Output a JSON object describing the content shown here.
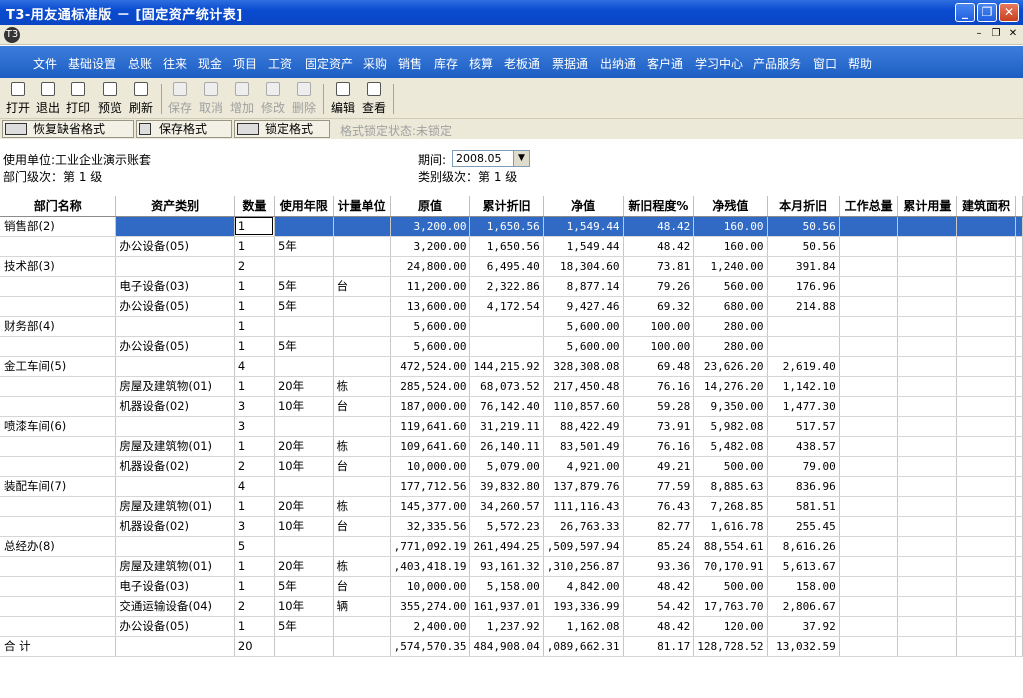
{
  "window": {
    "title": "T3-用友通标准版 － [固定资产统计表]",
    "minimize": "_",
    "restore": "❐",
    "close": "✕"
  },
  "mdi": {
    "app_icon": "T3",
    "minimize": "–",
    "restore": "❐",
    "close": "✕"
  },
  "menu": [
    "文件",
    "基础设置",
    "总账",
    "往来",
    "现金",
    "项目",
    "工资",
    "固定资产",
    "采购",
    "销售",
    "库存",
    "核算",
    "老板通",
    "票据通",
    "出纳通",
    "客户通",
    "学习中心",
    "产品服务",
    "窗口",
    "帮助"
  ],
  "toolbar": {
    "open": "打开",
    "exit": "退出",
    "print": "打印",
    "preview": "预览",
    "refresh": "刷新",
    "save": "保存",
    "cancel": "取消",
    "add": "增加",
    "modify": "修改",
    "delete": "删除",
    "edit": "编辑",
    "view": "查看"
  },
  "format": {
    "restore_default": "恢复缺省格式",
    "save_format": "保存格式",
    "lock_format": "锁定格式",
    "lock_state": "格式锁定状态:未锁定"
  },
  "info": {
    "unit_label": "使用单位:工业企业演示账套",
    "dept_level": "部门级次：第 1 级",
    "period_label": "期间:",
    "period_value": "2008.05",
    "category_level": "类别级次：第 1 级"
  },
  "table": {
    "headers": [
      "部门名称",
      "资产类别",
      "数量",
      "使用年限",
      "计量单位",
      "原值",
      "累计折旧",
      "净值",
      "新旧程度%",
      "净残值",
      "本月折旧",
      "工作总量",
      "累计用量",
      "建筑面积"
    ],
    "rows": [
      [
        "销售部(2)",
        "",
        "1",
        "",
        "",
        "3,200.00",
        "1,650.56",
        "1,549.44",
        "48.42",
        "160.00",
        "50.56"
      ],
      [
        "",
        "办公设备(05)",
        "1",
        "5年",
        "",
        "3,200.00",
        "1,650.56",
        "1,549.44",
        "48.42",
        "160.00",
        "50.56"
      ],
      [
        "技术部(3)",
        "",
        "2",
        "",
        "",
        "24,800.00",
        "6,495.40",
        "18,304.60",
        "73.81",
        "1,240.00",
        "391.84"
      ],
      [
        "",
        "电子设备(03)",
        "1",
        "5年",
        "台",
        "11,200.00",
        "2,322.86",
        "8,877.14",
        "79.26",
        "560.00",
        "176.96"
      ],
      [
        "",
        "办公设备(05)",
        "1",
        "5年",
        "",
        "13,600.00",
        "4,172.54",
        "9,427.46",
        "69.32",
        "680.00",
        "214.88"
      ],
      [
        "财务部(4)",
        "",
        "1",
        "",
        "",
        "5,600.00",
        "",
        "5,600.00",
        "100.00",
        "280.00",
        ""
      ],
      [
        "",
        "办公设备(05)",
        "1",
        "5年",
        "",
        "5,600.00",
        "",
        "5,600.00",
        "100.00",
        "280.00",
        ""
      ],
      [
        "金工车间(5)",
        "",
        "4",
        "",
        "",
        "472,524.00",
        "144,215.92",
        "328,308.08",
        "69.48",
        "23,626.20",
        "2,619.40"
      ],
      [
        "",
        "房屋及建筑物(01)",
        "1",
        "20年",
        "栋",
        "285,524.00",
        "68,073.52",
        "217,450.48",
        "76.16",
        "14,276.20",
        "1,142.10"
      ],
      [
        "",
        "机器设备(02)",
        "3",
        "10年",
        "台",
        "187,000.00",
        "76,142.40",
        "110,857.60",
        "59.28",
        "9,350.00",
        "1,477.30"
      ],
      [
        "喷漆车间(6)",
        "",
        "3",
        "",
        "",
        "119,641.60",
        "31,219.11",
        "88,422.49",
        "73.91",
        "5,982.08",
        "517.57"
      ],
      [
        "",
        "房屋及建筑物(01)",
        "1",
        "20年",
        "栋",
        "109,641.60",
        "26,140.11",
        "83,501.49",
        "76.16",
        "5,482.08",
        "438.57"
      ],
      [
        "",
        "机器设备(02)",
        "2",
        "10年",
        "台",
        "10,000.00",
        "5,079.00",
        "4,921.00",
        "49.21",
        "500.00",
        "79.00"
      ],
      [
        "装配车间(7)",
        "",
        "4",
        "",
        "",
        "177,712.56",
        "39,832.80",
        "137,879.76",
        "77.59",
        "8,885.63",
        "836.96"
      ],
      [
        "",
        "房屋及建筑物(01)",
        "1",
        "20年",
        "栋",
        "145,377.00",
        "34,260.57",
        "111,116.43",
        "76.43",
        "7,268.85",
        "581.51"
      ],
      [
        "",
        "机器设备(02)",
        "3",
        "10年",
        "台",
        "32,335.56",
        "5,572.23",
        "26,763.33",
        "82.77",
        "1,616.78",
        "255.45"
      ],
      [
        "总经办(8)",
        "",
        "5",
        "",
        "",
        ",771,092.19",
        "261,494.25",
        ",509,597.94",
        "85.24",
        "88,554.61",
        "8,616.26"
      ],
      [
        "",
        "房屋及建筑物(01)",
        "1",
        "20年",
        "栋",
        ",403,418.19",
        "93,161.32",
        ",310,256.87",
        "93.36",
        "70,170.91",
        "5,613.67"
      ],
      [
        "",
        "电子设备(03)",
        "1",
        "5年",
        "台",
        "10,000.00",
        "5,158.00",
        "4,842.00",
        "48.42",
        "500.00",
        "158.00"
      ],
      [
        "",
        "交通运输设备(04)",
        "2",
        "10年",
        "辆",
        "355,274.00",
        "161,937.01",
        "193,336.99",
        "54.42",
        "17,763.70",
        "2,806.67"
      ],
      [
        "",
        "办公设备(05)",
        "1",
        "5年",
        "",
        "2,400.00",
        "1,237.92",
        "1,162.08",
        "48.42",
        "120.00",
        "37.92"
      ],
      [
        " 合  计",
        "",
        "20",
        "",
        "",
        ",574,570.35",
        "484,908.04",
        ",089,662.31",
        "81.17",
        "128,728.52",
        "13,032.59"
      ]
    ]
  }
}
